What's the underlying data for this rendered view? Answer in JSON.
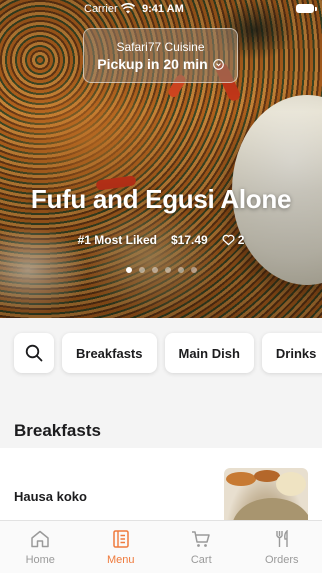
{
  "status_bar": {
    "carrier": "Carrier",
    "time": "9:41 AM"
  },
  "pickup": {
    "restaurant": "Safari77 Cuisine",
    "eta": "Pickup in 20 min"
  },
  "featured": {
    "title": "Fufu and Egusi Alone",
    "badge": "#1 Most Liked",
    "price": "$17.49",
    "likes": "2",
    "carousel_pages": 6,
    "carousel_active_index": 0
  },
  "categories": [
    "Breakfasts",
    "Main Dish",
    "Drinks"
  ],
  "menu": {
    "section_title": "Breakfasts",
    "items": [
      {
        "name": "Hausa koko"
      }
    ]
  },
  "tabs": [
    {
      "label": "Home",
      "icon": "home-icon"
    },
    {
      "label": "Menu",
      "icon": "menu-book-icon",
      "active": true
    },
    {
      "label": "Cart",
      "icon": "cart-icon"
    },
    {
      "label": "Orders",
      "icon": "fork-knife-icon"
    }
  ],
  "colors": {
    "accent": "#ef7a3c",
    "inactive": "#9a9a9a"
  }
}
